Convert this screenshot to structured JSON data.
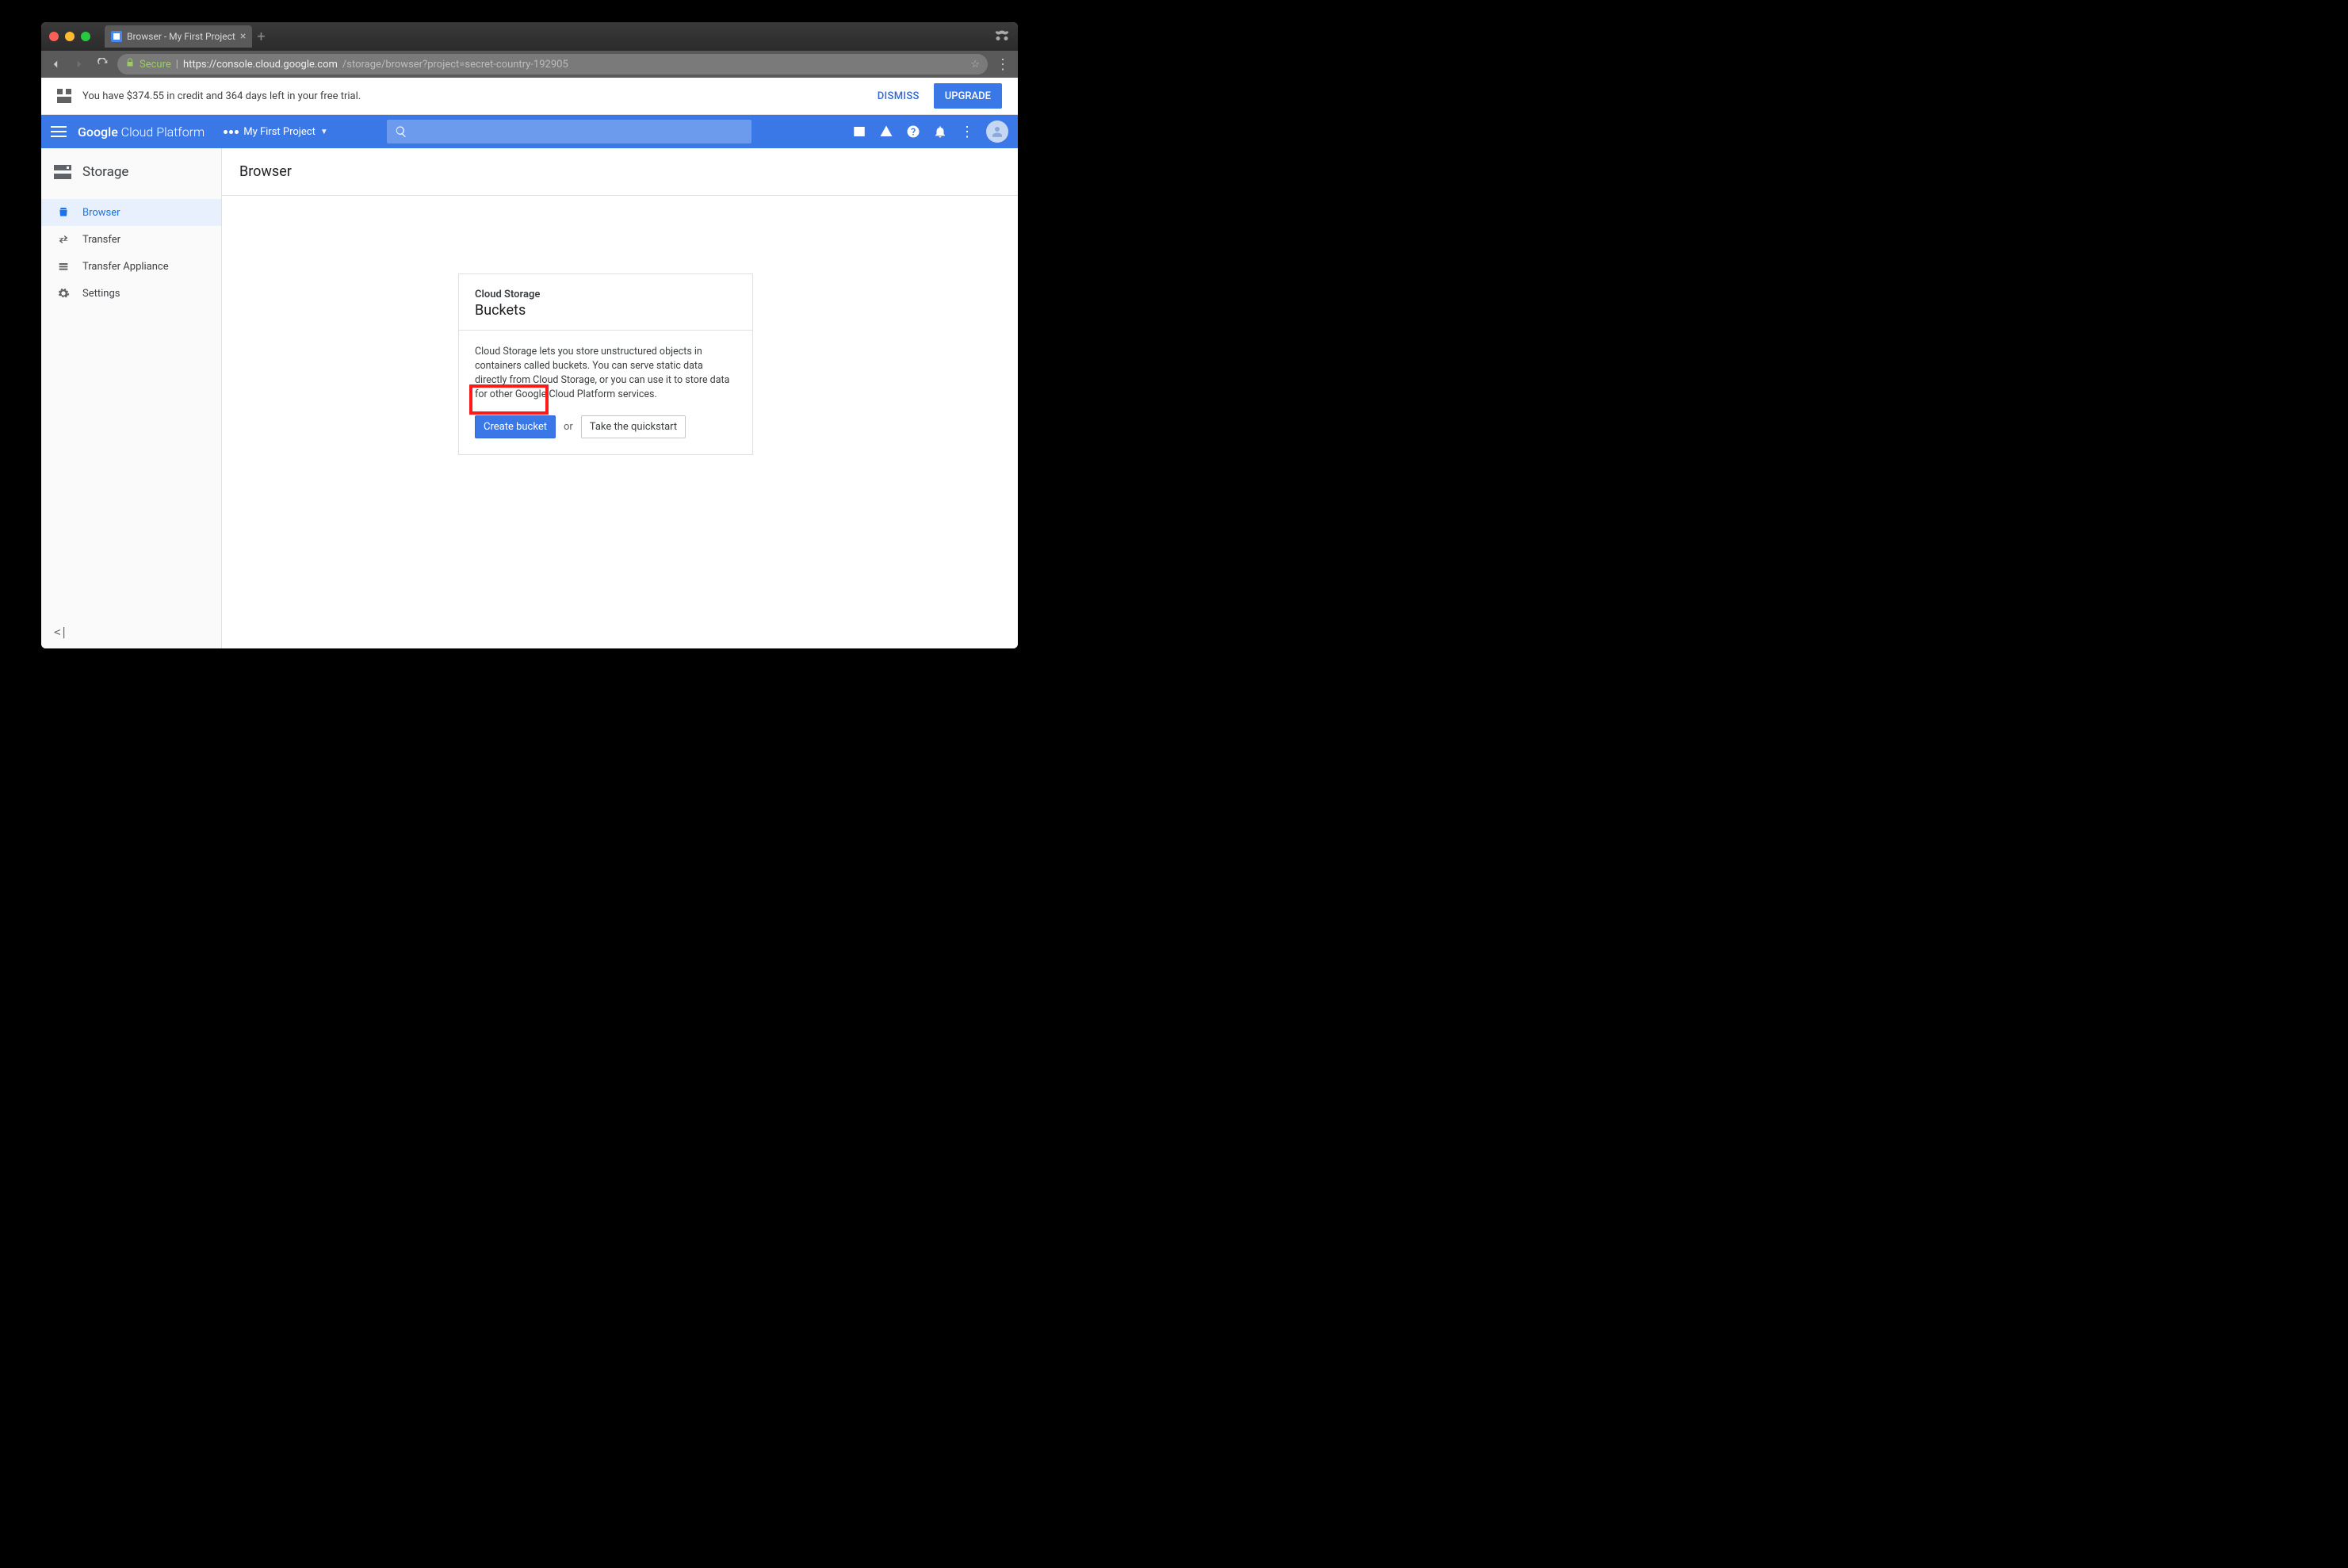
{
  "browser": {
    "tab_title": "Browser - My First Project",
    "secure_label": "Secure",
    "url_host": "https://console.cloud.google.com",
    "url_path": "/storage/browser?project=secret-country-192905"
  },
  "trial": {
    "message": "You have $374.55 in credit and 364 days left in your free trial.",
    "dismiss": "DISMISS",
    "upgrade": "UPGRADE"
  },
  "appbar": {
    "brand_bold": "Google",
    "brand_light": " Cloud Platform",
    "project": "My First Project"
  },
  "sidebar": {
    "service": "Storage",
    "items": [
      {
        "label": "Browser"
      },
      {
        "label": "Transfer"
      },
      {
        "label": "Transfer Appliance"
      },
      {
        "label": "Settings"
      }
    ]
  },
  "page": {
    "title": "Browser"
  },
  "card": {
    "eyebrow": "Cloud Storage",
    "title": "Buckets",
    "desc": "Cloud Storage lets you store unstructured objects in containers called buckets. You can serve static data directly from Cloud Storage, or you can use it to store data for other Google Cloud Platform services.",
    "create": "Create bucket",
    "or": "or",
    "quickstart": "Take the quickstart"
  }
}
